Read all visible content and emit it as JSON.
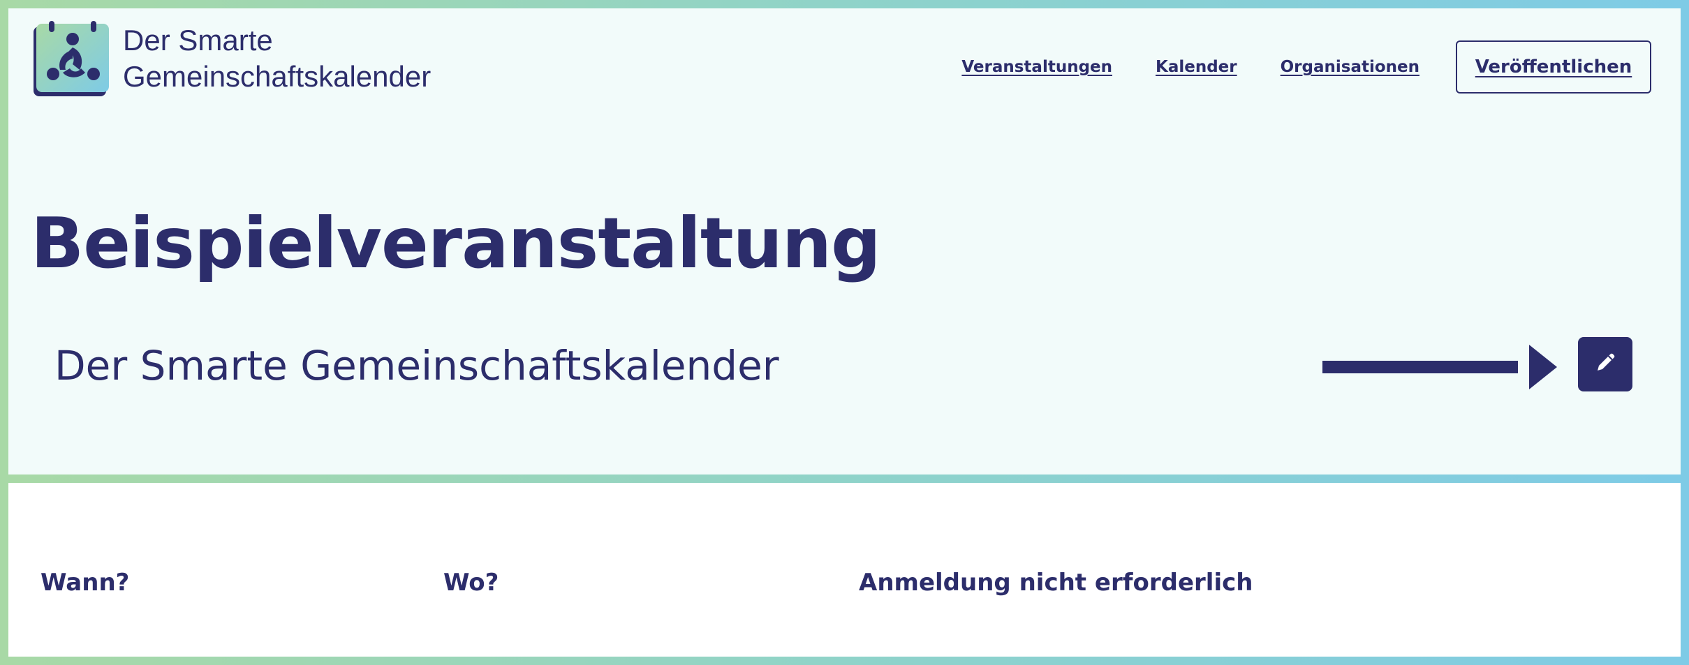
{
  "brand": {
    "line1": "Der Smarte",
    "line2": "Gemeinschaftskalender"
  },
  "nav": {
    "events": "Veranstaltungen",
    "calendar": "Kalender",
    "organizations": "Organisationen",
    "publish": "Veröffentlichen"
  },
  "event": {
    "title": "Beispielveranstaltung",
    "organizer": "Der Smarte Gemeinschaftskalender"
  },
  "details": {
    "when": "Wann?",
    "where": "Wo?",
    "registration": "Anmeldung nicht erforderlich"
  },
  "icons": {
    "logo": "community-calendar-logo-icon",
    "arrow": "arrow-right-icon",
    "edit": "pencil-icon"
  },
  "colors": {
    "primary": "#2c2d6b",
    "background": "#f2fbfa",
    "gradient_start": "#a8d9a6",
    "gradient_end": "#7ecbe6"
  }
}
